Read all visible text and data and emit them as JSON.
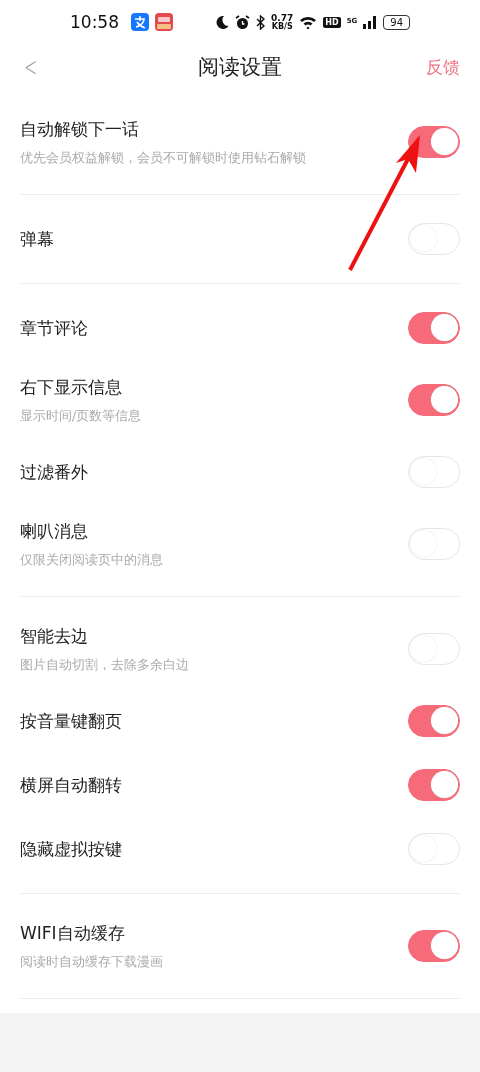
{
  "status_bar": {
    "time": "10:58",
    "net_speed": "0.77",
    "net_unit": "KB/S",
    "hd": "HD",
    "network": "5G",
    "battery": "94"
  },
  "header": {
    "back": "<",
    "title": "阅读设置",
    "action": "反馈"
  },
  "sections": [
    {
      "items": [
        {
          "title": "自动解锁下一话",
          "subtitle": "优先会员权益解锁，会员不可解锁时使用钻石解锁",
          "on": true
        }
      ]
    },
    {
      "items": [
        {
          "title": "弹幕",
          "on": false
        }
      ]
    },
    {
      "items": [
        {
          "title": "章节评论",
          "on": true
        },
        {
          "title": "右下显示信息",
          "subtitle": "显示时间/页数等信息",
          "on": true
        },
        {
          "title": "过滤番外",
          "on": false
        },
        {
          "title": "喇叭消息",
          "subtitle": "仅限关闭阅读页中的消息",
          "on": false
        }
      ]
    },
    {
      "items": [
        {
          "title": "智能去边",
          "subtitle": "图片自动切割，去除多余白边",
          "on": false
        },
        {
          "title": "按音量键翻页",
          "on": true
        },
        {
          "title": "横屏自动翻转",
          "on": true
        },
        {
          "title": "隐藏虚拟按键",
          "on": false
        }
      ]
    },
    {
      "items": [
        {
          "title": "WIFI自动缓存",
          "subtitle": "阅读时自动缓存下载漫画",
          "on": true
        }
      ]
    }
  ]
}
